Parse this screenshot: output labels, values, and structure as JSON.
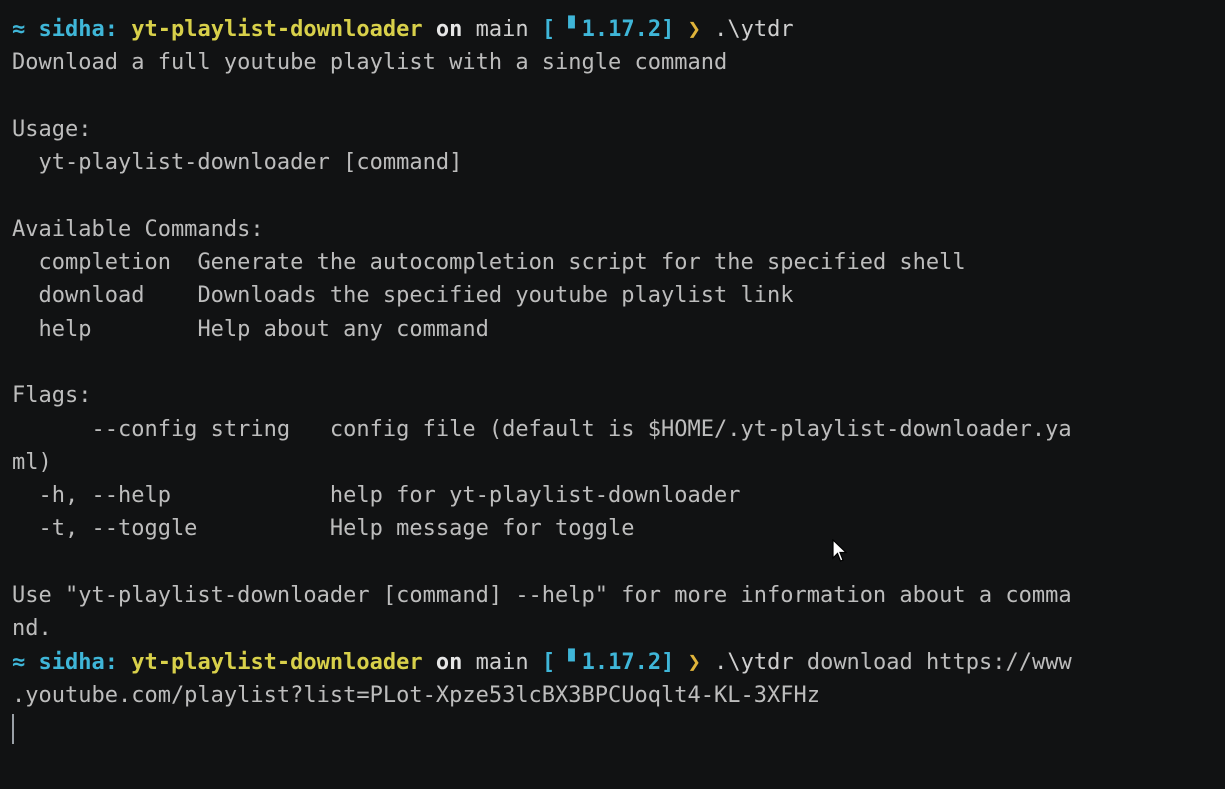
{
  "prompt": {
    "icon": "≈",
    "user": "sidha:",
    "dir": "yt-playlist-downloader",
    "on": "on",
    "branch": "main",
    "status_open": "[",
    "pkg_icon": "▘",
    "version": "1.17.2]",
    "chevron": "❯"
  },
  "cmd1": ".\\ytdr",
  "output": {
    "description": "Download a full youtube playlist with a single command",
    "usage_header": "Usage:",
    "usage_cmd": "  yt-playlist-downloader [command]",
    "commands_header": "Available Commands:",
    "commands": [
      {
        "name": "  completion  ",
        "desc": "Generate the autocompletion script for the specified shell"
      },
      {
        "name": "  download    ",
        "desc": "Downloads the specified youtube playlist link"
      },
      {
        "name": "  help        ",
        "desc": "Help about any command"
      }
    ],
    "flags_header": "Flags:",
    "flags": [
      "      --config string   config file (default is $HOME/.yt-playlist-downloader.ya",
      "ml)",
      "  -h, --help            help for yt-playlist-downloader",
      "  -t, --toggle          Help message for toggle"
    ],
    "footer_1": "Use \"yt-playlist-downloader [command] --help\" for more information about a comma",
    "footer_2": "nd."
  },
  "cmd2": {
    "exe": ".\\ytdr",
    "args_1": " download https://www",
    "args_2": ".youtube.com/playlist?list=PLot-Xpze53lcBX3BPCUoqlt4-KL-3XFHz"
  },
  "icons": {
    "cursor": "mouse-pointer-icon"
  }
}
